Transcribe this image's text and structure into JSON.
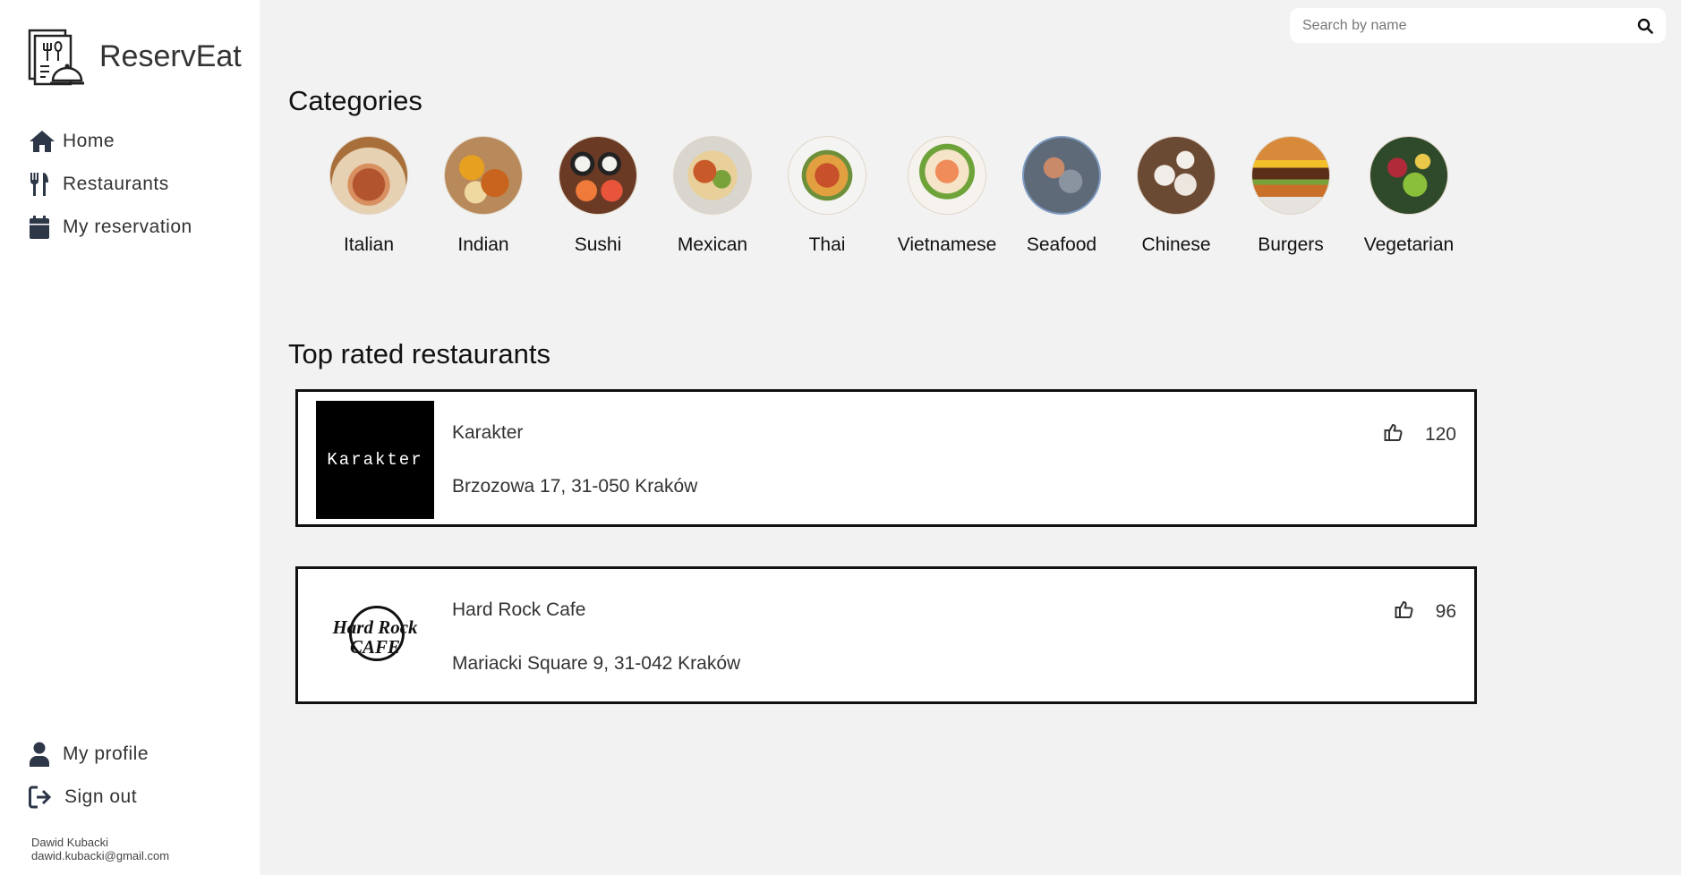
{
  "brand": {
    "name": "ReservEat"
  },
  "nav": {
    "items": [
      {
        "label": "Home",
        "icon": "home-icon"
      },
      {
        "label": "Restaurants",
        "icon": "utensils-icon"
      },
      {
        "label": "My reservation",
        "icon": "calendar-icon"
      }
    ],
    "bottom": [
      {
        "label": "My profile",
        "icon": "user-icon"
      },
      {
        "label": "Sign out",
        "icon": "sign-out-icon"
      }
    ]
  },
  "user": {
    "name": "Dawid Kubacki",
    "email": "dawid.kubacki@gmail.com"
  },
  "search": {
    "placeholder": "Search by name",
    "value": ""
  },
  "categories": {
    "title": "Categories",
    "items": [
      {
        "label": "Italian"
      },
      {
        "label": "Indian"
      },
      {
        "label": "Sushi"
      },
      {
        "label": "Mexican"
      },
      {
        "label": "Thai"
      },
      {
        "label": "Vietnamese"
      },
      {
        "label": "Seafood"
      },
      {
        "label": "Chinese"
      },
      {
        "label": "Burgers"
      },
      {
        "label": "Vegetarian"
      }
    ]
  },
  "top_rated": {
    "title": "Top rated restaurants",
    "restaurants": [
      {
        "name": "Karakter",
        "address": "Brzozowa 17, 31-050 Kraków",
        "likes": "120",
        "logo_text": "Karakter"
      },
      {
        "name": "Hard Rock Cafe",
        "address": "Mariacki Square 9, 31-042 Kraków",
        "likes": "96",
        "logo_text": "Hard Rock CAFE"
      }
    ]
  },
  "colors": {
    "sidebar_bg": "#ffffff",
    "main_bg": "#f2f2f2",
    "nav_icon": "#2d3748",
    "card_border": "#111111"
  }
}
